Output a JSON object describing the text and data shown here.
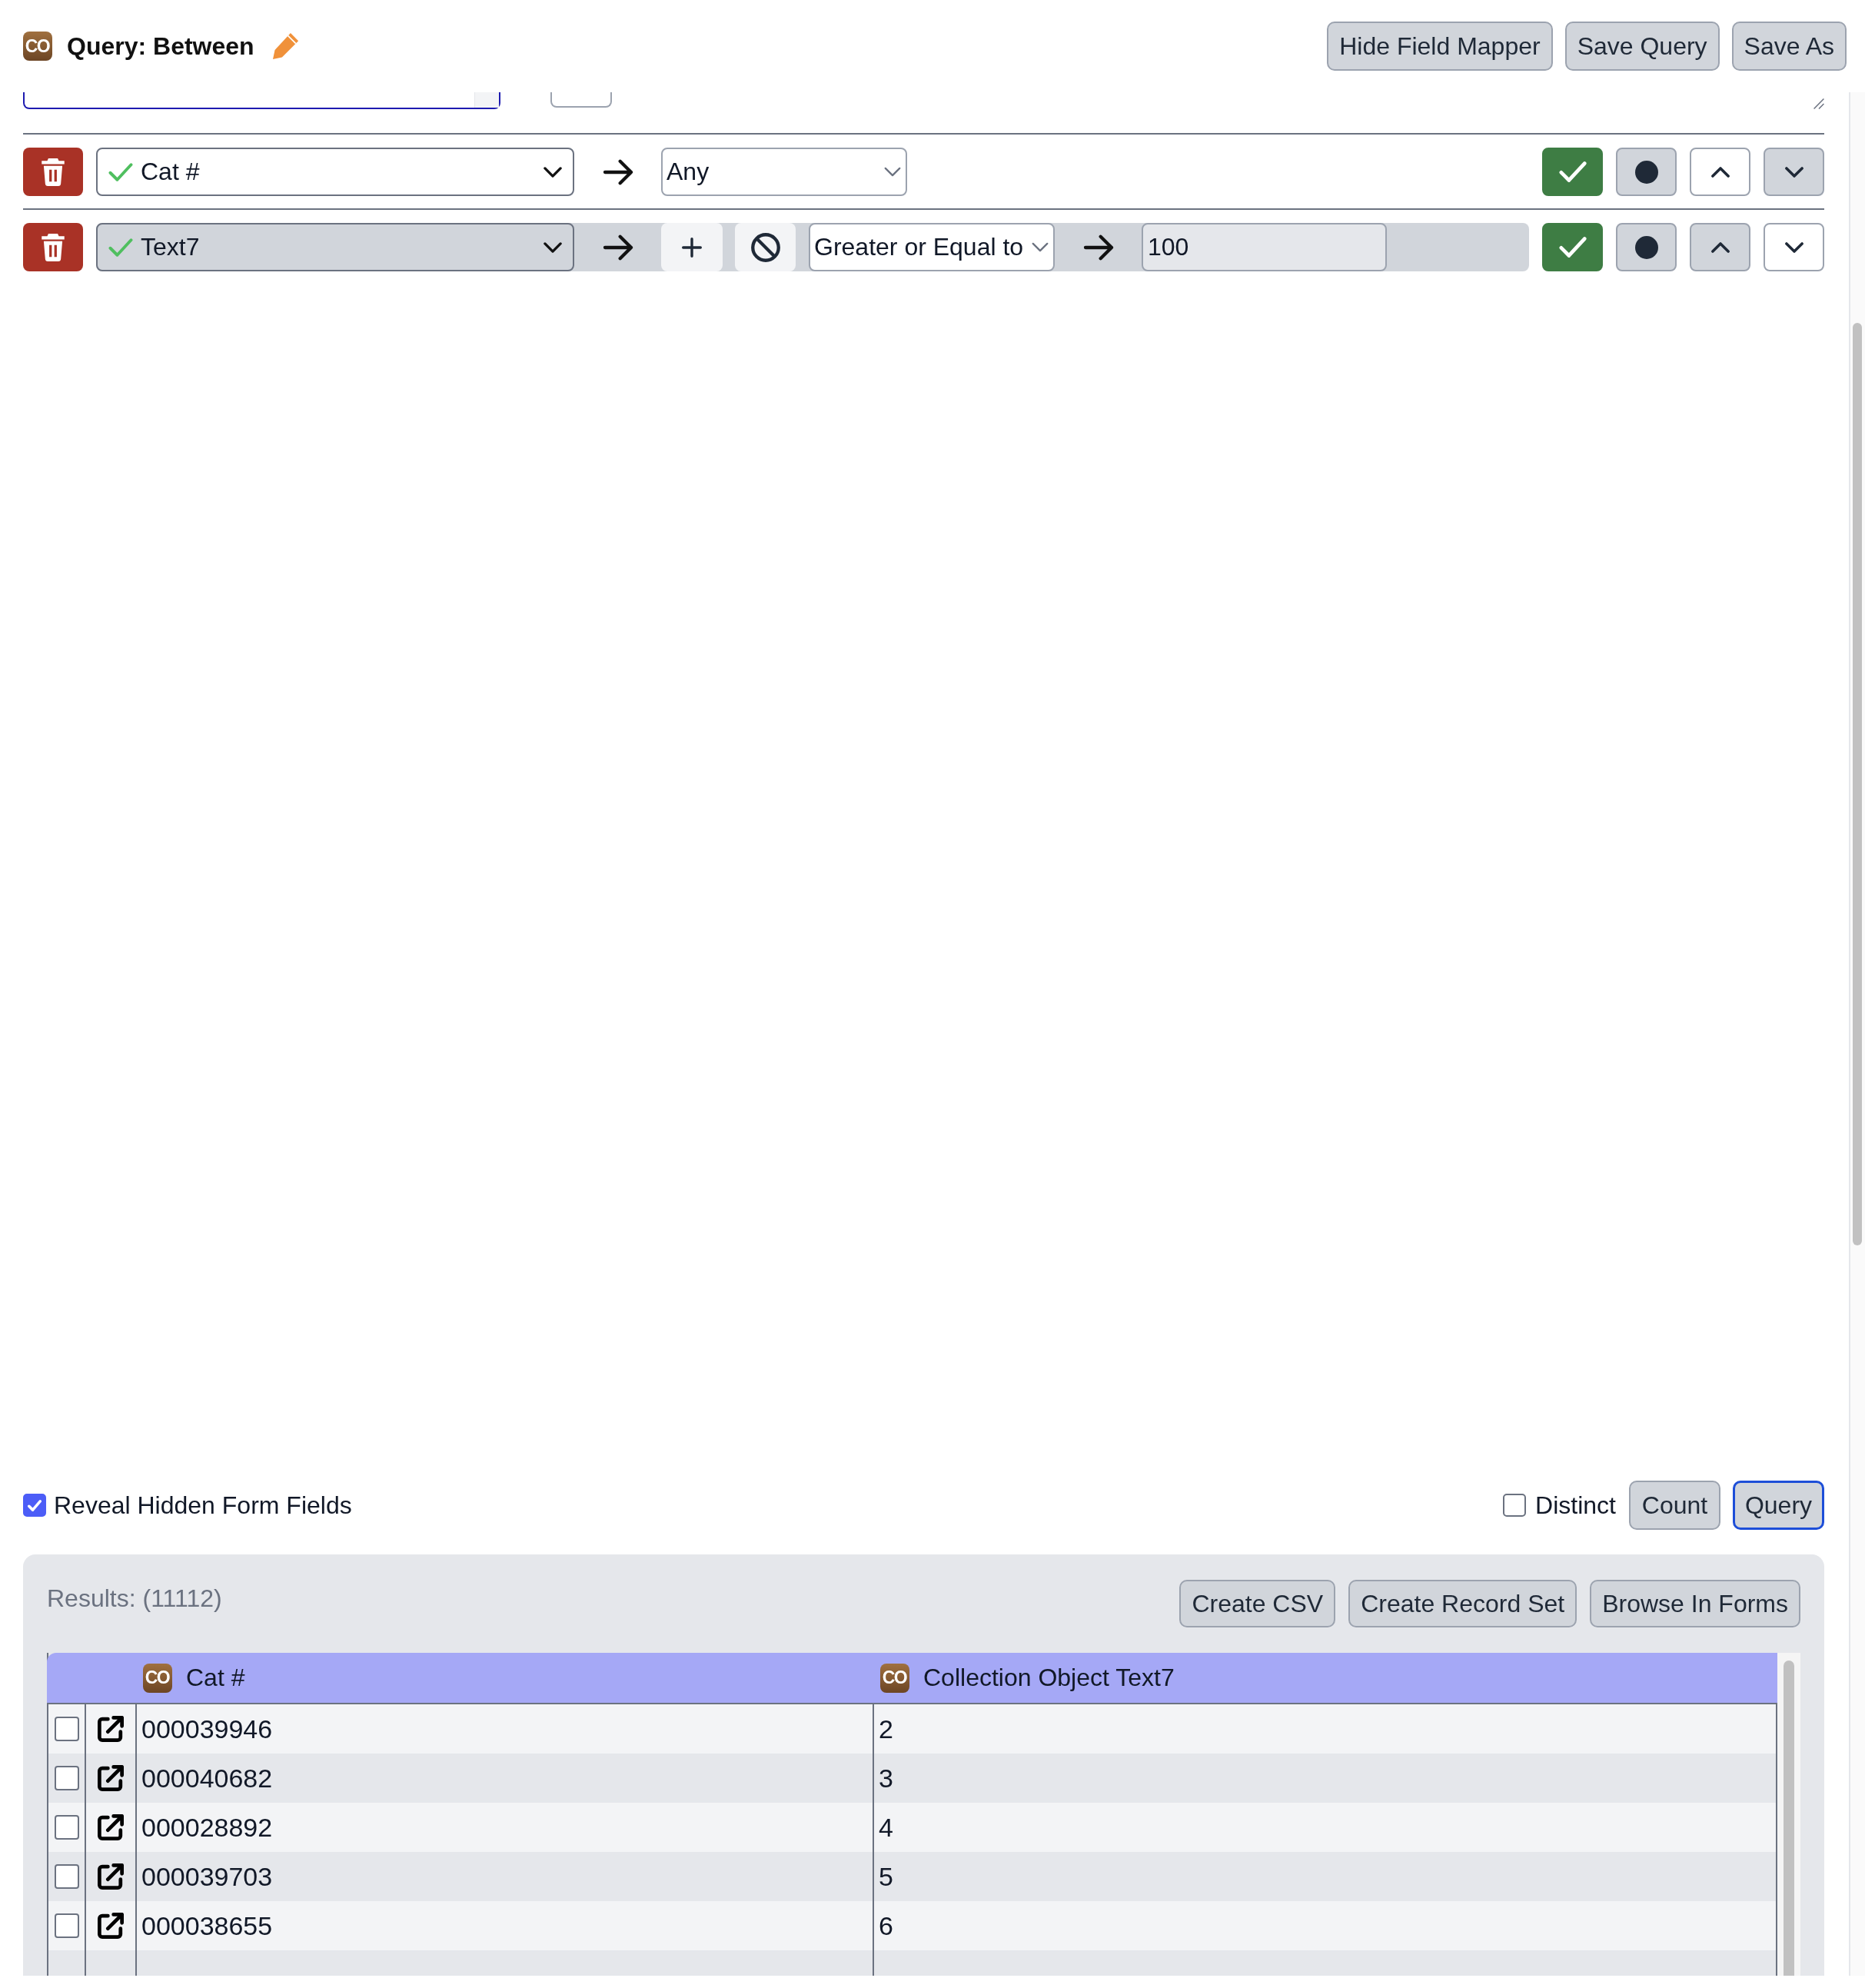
{
  "header": {
    "table_icon": "CO",
    "title": "Query: Between",
    "buttons": [
      "Hide Field Mapper",
      "Save Query",
      "Save As"
    ]
  },
  "lines": [
    {
      "field": "Cat #",
      "selected": false,
      "operator": "Any",
      "show_in_results": true,
      "move_up_disabled": true,
      "move_down_disabled": false
    },
    {
      "field": "Text7",
      "selected": true,
      "operator": "Greater or Equal to",
      "value": "100",
      "show_in_results": true,
      "move_up_disabled": false,
      "move_down_disabled": true
    }
  ],
  "options": {
    "reveal_hidden_fields": {
      "label": "Reveal Hidden Form Fields",
      "checked": true
    },
    "distinct": {
      "label": "Distinct",
      "checked": false
    },
    "buttons": [
      {
        "label": "Count",
        "focused": false
      },
      {
        "label": "Query",
        "focused": true
      }
    ]
  },
  "results": {
    "title": "Results: (11112)",
    "buttons": [
      "Create CSV",
      "Create Record Set",
      "Browse In Forms"
    ],
    "columns": [
      {
        "table_icon": "CO",
        "label": "Cat #"
      },
      {
        "table_icon": "CO",
        "label": "Collection Object Text7"
      }
    ],
    "rows": [
      {
        "checked": false,
        "cells": [
          "000039946",
          "2"
        ]
      },
      {
        "checked": false,
        "cells": [
          "000040682",
          "3"
        ]
      },
      {
        "checked": false,
        "cells": [
          "000028892",
          "4"
        ]
      },
      {
        "checked": false,
        "cells": [
          "000039703",
          "5"
        ]
      },
      {
        "checked": false,
        "cells": [
          "000038655",
          "6"
        ]
      }
    ]
  }
}
